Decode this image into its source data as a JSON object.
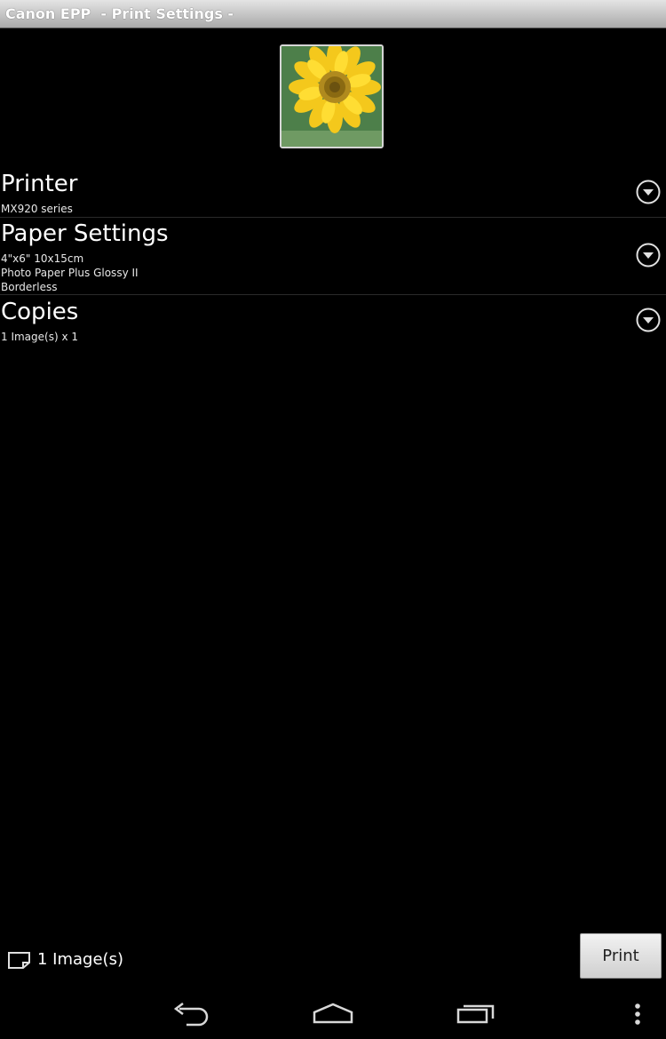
{
  "titlebar": {
    "title": "Canon EPP  - Print Settings -"
  },
  "settings": [
    {
      "title": "Printer",
      "lines": [
        "MX920 series"
      ]
    },
    {
      "title": "Paper Settings",
      "lines": [
        "4\"x6\" 10x15cm",
        "Photo Paper Plus Glossy II",
        "Borderless"
      ]
    },
    {
      "title": "Copies",
      "lines": [
        "1 Image(s) x 1"
      ]
    }
  ],
  "footer": {
    "image_count": "1 Image(s)",
    "print_label": "Print"
  },
  "icons": {
    "thumbnail": "sunflower-photo",
    "expand": "chevron-down-circle-icon",
    "count": "image-stack-icon",
    "nav_back": "back-icon",
    "nav_home": "home-icon",
    "nav_recents": "recent-apps-icon",
    "nav_menu": "overflow-menu-icon"
  }
}
